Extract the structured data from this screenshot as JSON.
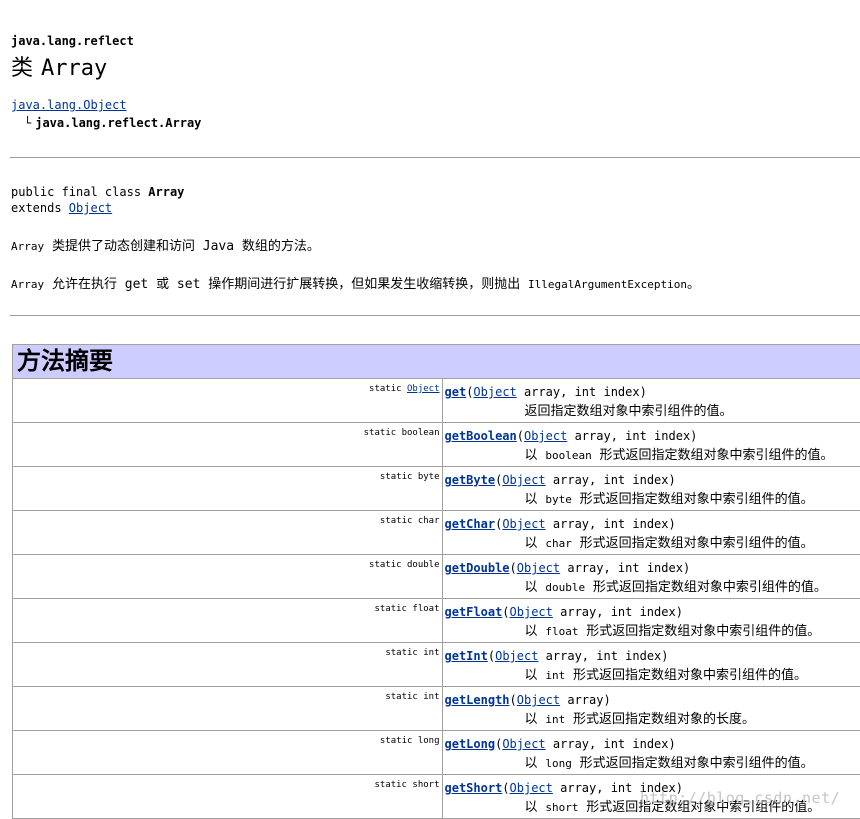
{
  "package_name": "java.lang.reflect",
  "title": {
    "prefix": "类",
    "class_name": "Array"
  },
  "hierarchy": {
    "parent": "java.lang.Object",
    "elbow": "└",
    "child": "java.lang.reflect.Array"
  },
  "declaration": {
    "line1_prefix": "public final class ",
    "line1_name": "Array",
    "line2_prefix": "extends ",
    "line2_link": "Object"
  },
  "description": {
    "p1_code": "Array",
    "p1_text": " 类提供了动态创建和访问 Java 数组的方法。",
    "p2_code1": "Array",
    "p2_text1": " 允许在执行 get 或 set 操作期间进行扩展转换，但如果发生收缩转换，则抛出 ",
    "p2_code2": "IllegalArgumentException",
    "p2_text2": "。"
  },
  "method_summary": {
    "heading": "方法摘要",
    "methods": [
      {
        "modifier": "static ",
        "return_link": "Object",
        "return_type": "",
        "name": "get",
        "param_link": "Object",
        "params": " array, int index)",
        "desc_pre": "返回指定数组对象中索引组件的值。",
        "desc_code": "",
        "desc_post": ""
      },
      {
        "modifier": "static boolean",
        "return_link": "",
        "return_type": "",
        "name": "getBoolean",
        "param_link": "Object",
        "params": " array, int index)",
        "desc_pre": "以 ",
        "desc_code": "boolean",
        "desc_post": " 形式返回指定数组对象中索引组件的值。"
      },
      {
        "modifier": "static byte",
        "return_link": "",
        "return_type": "",
        "name": "getByte",
        "param_link": "Object",
        "params": " array, int index)",
        "desc_pre": "以 ",
        "desc_code": "byte",
        "desc_post": " 形式返回指定数组对象中索引组件的值。"
      },
      {
        "modifier": "static char",
        "return_link": "",
        "return_type": "",
        "name": "getChar",
        "param_link": "Object",
        "params": " array, int index)",
        "desc_pre": "以 ",
        "desc_code": "char",
        "desc_post": " 形式返回指定数组对象中索引组件的值。"
      },
      {
        "modifier": "static double",
        "return_link": "",
        "return_type": "",
        "name": "getDouble",
        "param_link": "Object",
        "params": " array, int index)",
        "desc_pre": "以 ",
        "desc_code": "double",
        "desc_post": " 形式返回指定数组对象中索引组件的值。"
      },
      {
        "modifier": "static float",
        "return_link": "",
        "return_type": "",
        "name": "getFloat",
        "param_link": "Object",
        "params": " array, int index)",
        "desc_pre": "以 ",
        "desc_code": "float",
        "desc_post": " 形式返回指定数组对象中索引组件的值。"
      },
      {
        "modifier": "static int",
        "return_link": "",
        "return_type": "",
        "name": "getInt",
        "param_link": "Object",
        "params": " array, int index)",
        "desc_pre": "以 ",
        "desc_code": "int",
        "desc_post": " 形式返回指定数组对象中索引组件的值。"
      },
      {
        "modifier": "static int",
        "return_link": "",
        "return_type": "",
        "name": "getLength",
        "param_link": "Object",
        "params": " array)",
        "desc_pre": "以 ",
        "desc_code": "int",
        "desc_post": " 形式返回指定数组对象的长度。"
      },
      {
        "modifier": "static long",
        "return_link": "",
        "return_type": "",
        "name": "getLong",
        "param_link": "Object",
        "params": " array, int index)",
        "desc_pre": "以 ",
        "desc_code": "long",
        "desc_post": " 形式返回指定数组对象中索引组件的值。"
      },
      {
        "modifier": "static short",
        "return_link": "",
        "return_type": "",
        "name": "getShort",
        "param_link": "Object",
        "params": " array, int index)",
        "desc_pre": "以 ",
        "desc_code": "short",
        "desc_post": " 形式返回指定数组对象中索引组件的值。"
      }
    ]
  },
  "watermark": "http://blog.csdn.net/"
}
